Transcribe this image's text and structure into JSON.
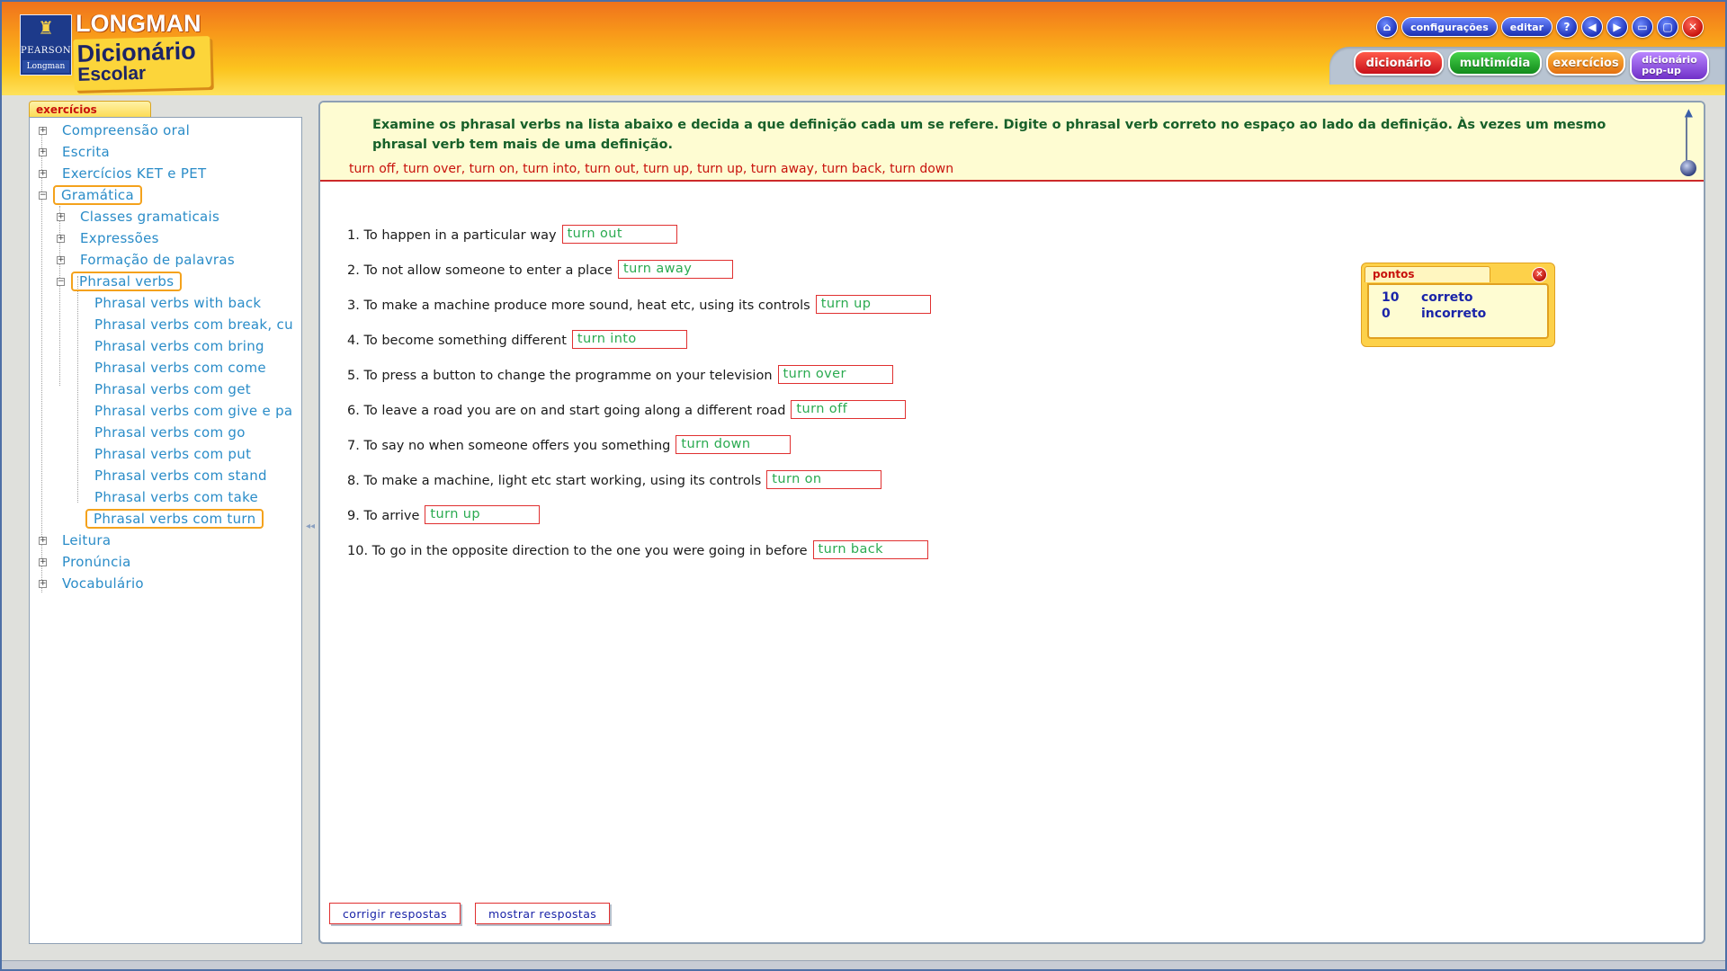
{
  "header": {
    "logo_small": "PEARSON",
    "logo_small_sub": "Longman",
    "brand": "LONGMAN",
    "title_line1": "Dicionário",
    "title_line2": "Escolar",
    "controls": {
      "config_label": "configurações",
      "edit_label": "editar"
    },
    "tabs": {
      "dict": "dicionário",
      "multi": "multimídia",
      "exer": "exercícios",
      "popup_line1": "dicionário",
      "popup_line2": "pop-up"
    }
  },
  "sidebar": {
    "tab_label": "exercícios",
    "items": [
      {
        "label": "Compreensão oral"
      },
      {
        "label": "Escrita"
      },
      {
        "label": "Exercícios KET e PET"
      },
      {
        "label": "Gramática"
      },
      {
        "label": "Classes gramaticais"
      },
      {
        "label": "Expressões"
      },
      {
        "label": "Formação de palavras"
      },
      {
        "label": "Phrasal verbs"
      },
      {
        "label": "Phrasal verbs with back"
      },
      {
        "label": "Phrasal verbs com break, cu"
      },
      {
        "label": "Phrasal verbs com bring"
      },
      {
        "label": "Phrasal verbs com come"
      },
      {
        "label": "Phrasal verbs com get"
      },
      {
        "label": "Phrasal verbs com give e pa"
      },
      {
        "label": "Phrasal verbs com go"
      },
      {
        "label": "Phrasal verbs com put"
      },
      {
        "label": "Phrasal verbs com stand"
      },
      {
        "label": "Phrasal verbs com take"
      },
      {
        "label": "Phrasal verbs com turn"
      },
      {
        "label": "Leitura"
      },
      {
        "label": "Pronúncia"
      },
      {
        "label": "Vocabulário"
      }
    ]
  },
  "main": {
    "instruction": "Examine os phrasal verbs na lista abaixo e decida a que definição cada um se refere. Digite o phrasal verb correto no espaço ao lado da definição. Às vezes um mesmo phrasal verb tem mais de uma definição.",
    "word_list": "turn off, turn over, turn on, turn into, turn out, turn up, turn up, turn away, turn back, turn down",
    "questions": [
      {
        "text": "1. To happen in a particular way",
        "answer": "turn out"
      },
      {
        "text": "2. To not allow someone to enter a place",
        "answer": "turn away"
      },
      {
        "text": "3. To make a machine produce more sound, heat etc, using its controls",
        "answer": "turn up"
      },
      {
        "text": "4. To become something different",
        "answer": "turn into"
      },
      {
        "text": "5. To press a button to change the programme on your television",
        "answer": "turn over"
      },
      {
        "text": "6. To leave a road you are on and start going along a different road",
        "answer": "turn off"
      },
      {
        "text": "7. To say no when someone offers you something",
        "answer": "turn down"
      },
      {
        "text": "8. To make a machine, light etc start working, using its controls",
        "answer": "turn on"
      },
      {
        "text": "9. To arrive",
        "answer": "turn up"
      },
      {
        "text": "10. To go in the opposite direction to the one you were going in before",
        "answer": "turn back"
      }
    ],
    "buttons": {
      "check": "corrigir respostas",
      "show": "mostrar respostas"
    }
  },
  "score": {
    "title": "pontos",
    "correct_count": "10",
    "correct_label": "correto",
    "incorrect_count": "0",
    "incorrect_label": "incorreto"
  }
}
